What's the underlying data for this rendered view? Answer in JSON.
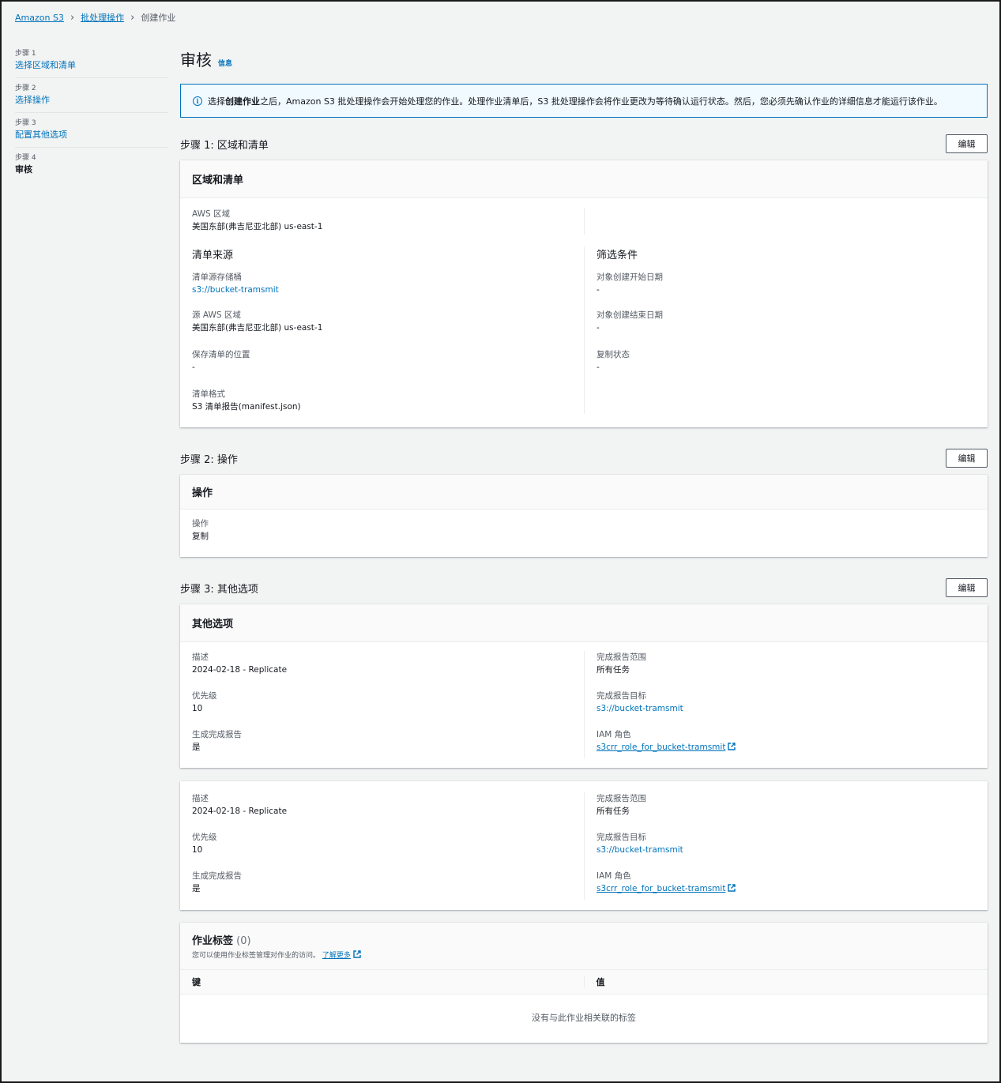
{
  "breadcrumb": {
    "items": [
      "Amazon S3",
      "批处理操作"
    ],
    "current": "创建作业"
  },
  "sidenav": {
    "steps": [
      {
        "no": "步骤 1",
        "label": "选择区域和清单"
      },
      {
        "no": "步骤 2",
        "label": "选择操作"
      },
      {
        "no": "步骤 3",
        "label": "配置其他选项"
      },
      {
        "no": "步骤 4",
        "label": "审核"
      }
    ]
  },
  "page": {
    "title": "审核",
    "info": "信息",
    "alert_pre": "选择",
    "alert_bold": "创建作业",
    "alert_post": "之后，Amazon S3 批处理操作会开始处理您的作业。处理作业清单后，S3 批处理操作会将作业更改为等待确认运行状态。然后，您必须先确认作业的详细信息才能运行该作业。",
    "edit": "编辑"
  },
  "step1": {
    "heading": "步骤 1: 区域和清单",
    "card_title": "区域和清单",
    "aws_region_k": "AWS 区域",
    "aws_region_v": "美国东部(弗吉尼亚北部) us-east-1",
    "manifest_source": "清单来源",
    "bucket_k": "清单源存储桶",
    "bucket_v": "s3://bucket-tramsmit",
    "src_region_k": "源 AWS 区域",
    "src_region_v": "美国东部(弗吉尼亚北部) us-east-1",
    "save_loc_k": "保存清单的位置",
    "save_loc_v": "-",
    "format_k": "清单格式",
    "format_v": "S3 清单报告(manifest.json)",
    "filters": "筛选条件",
    "start_k": "对象创建开始日期",
    "start_v": "-",
    "end_k": "对象创建结束日期",
    "end_v": "-",
    "repl_k": "复制状态",
    "repl_v": "-"
  },
  "step2": {
    "heading": "步骤 2: 操作",
    "card_title": "操作",
    "op_k": "操作",
    "op_v": "复制"
  },
  "step3": {
    "heading": "步骤 3: 其他选项",
    "card_title": "其他选项",
    "desc_k": "描述",
    "desc_v": "2024-02-18 - Replicate",
    "prio_k": "优先级",
    "prio_v": "10",
    "gen_k": "生成完成报告",
    "gen_v": "是",
    "scope_k": "完成报告范围",
    "scope_v": "所有任务",
    "target_k": "完成报告目标",
    "target_v": "s3://bucket-tramsmit",
    "iam_k": "IAM 角色",
    "iam_v": "s3crr_role_for_bucket-tramsmit"
  },
  "tags": {
    "title": "作业标签",
    "count": "(0)",
    "desc": "您可以使用作业标签管理对作业的访问。",
    "learn_more": "了解更多",
    "col_key": "键",
    "col_value": "值",
    "empty": "没有与此作业相关联的标签"
  }
}
